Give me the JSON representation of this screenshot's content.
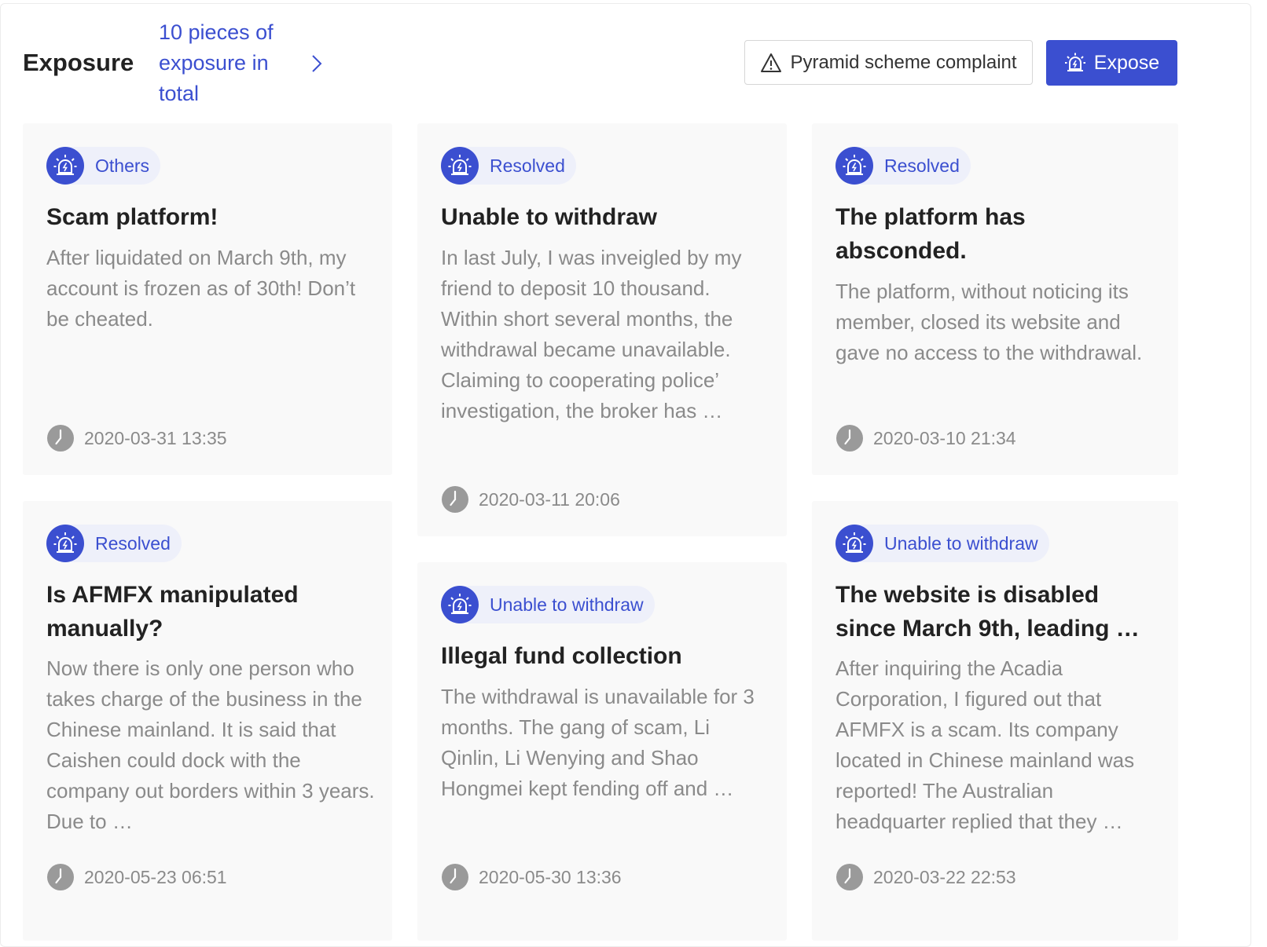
{
  "header": {
    "title": "Exposure",
    "count_link": "10 pieces of exposure in total",
    "complaint_button": "Pyramid scheme complaint",
    "expose_button": "Expose"
  },
  "cards": [
    {
      "tag": "Others",
      "title": "Scam platform!",
      "body": "After liquidated on March 9th, my account is frozen as of 30th! Don’t be cheated.",
      "time": "2020-03-31 13:35"
    },
    {
      "tag": "Resolved",
      "title": "Unable to withdraw",
      "body": "In last July, I was inveigled by my friend to deposit 10 thousand. Within short several months, the withdrawal became unavailable. Claiming to cooperating police’ investigation, the broker has …",
      "time": "2020-03-11 20:06"
    },
    {
      "tag": "Resolved",
      "title": "The platform has absconded.",
      "body": "The platform, without noticing its member, closed its website and gave no access to the withdrawal.",
      "time": "2020-03-10 21:34"
    },
    {
      "tag": "Resolved",
      "title": "Is AFMFX manipulated manually?",
      "body": "Now there is only one person who takes charge of the business in the Chinese mainland. It is said that Caishen could dock with the company out borders within 3 years. Due to …",
      "time": "2020-05-23 06:51"
    },
    {
      "tag": "Unable to withdraw",
      "title": "Illegal fund collection",
      "body": "The withdrawal is unavailable for 3 months. The gang of scam, Li Qinlin, Li Wenying and Shao Hongmei kept fending off and …",
      "time": "2020-05-30 13:36"
    },
    {
      "tag": "Unable to withdraw",
      "title": "The website is disabled since March 9th, leading …",
      "body": "After inquiring the Acadia Corporation, I figured out that AFMFX is a scam. Its company located in Chinese mainland was reported! The Australian headquarter replied that they …",
      "time": "2020-03-22 22:53"
    }
  ],
  "colors": {
    "accent": "#3b4fd0",
    "tag_bg": "#eef0fa",
    "card_bg": "#f9f9f9",
    "muted_text": "#8a8a8a"
  }
}
